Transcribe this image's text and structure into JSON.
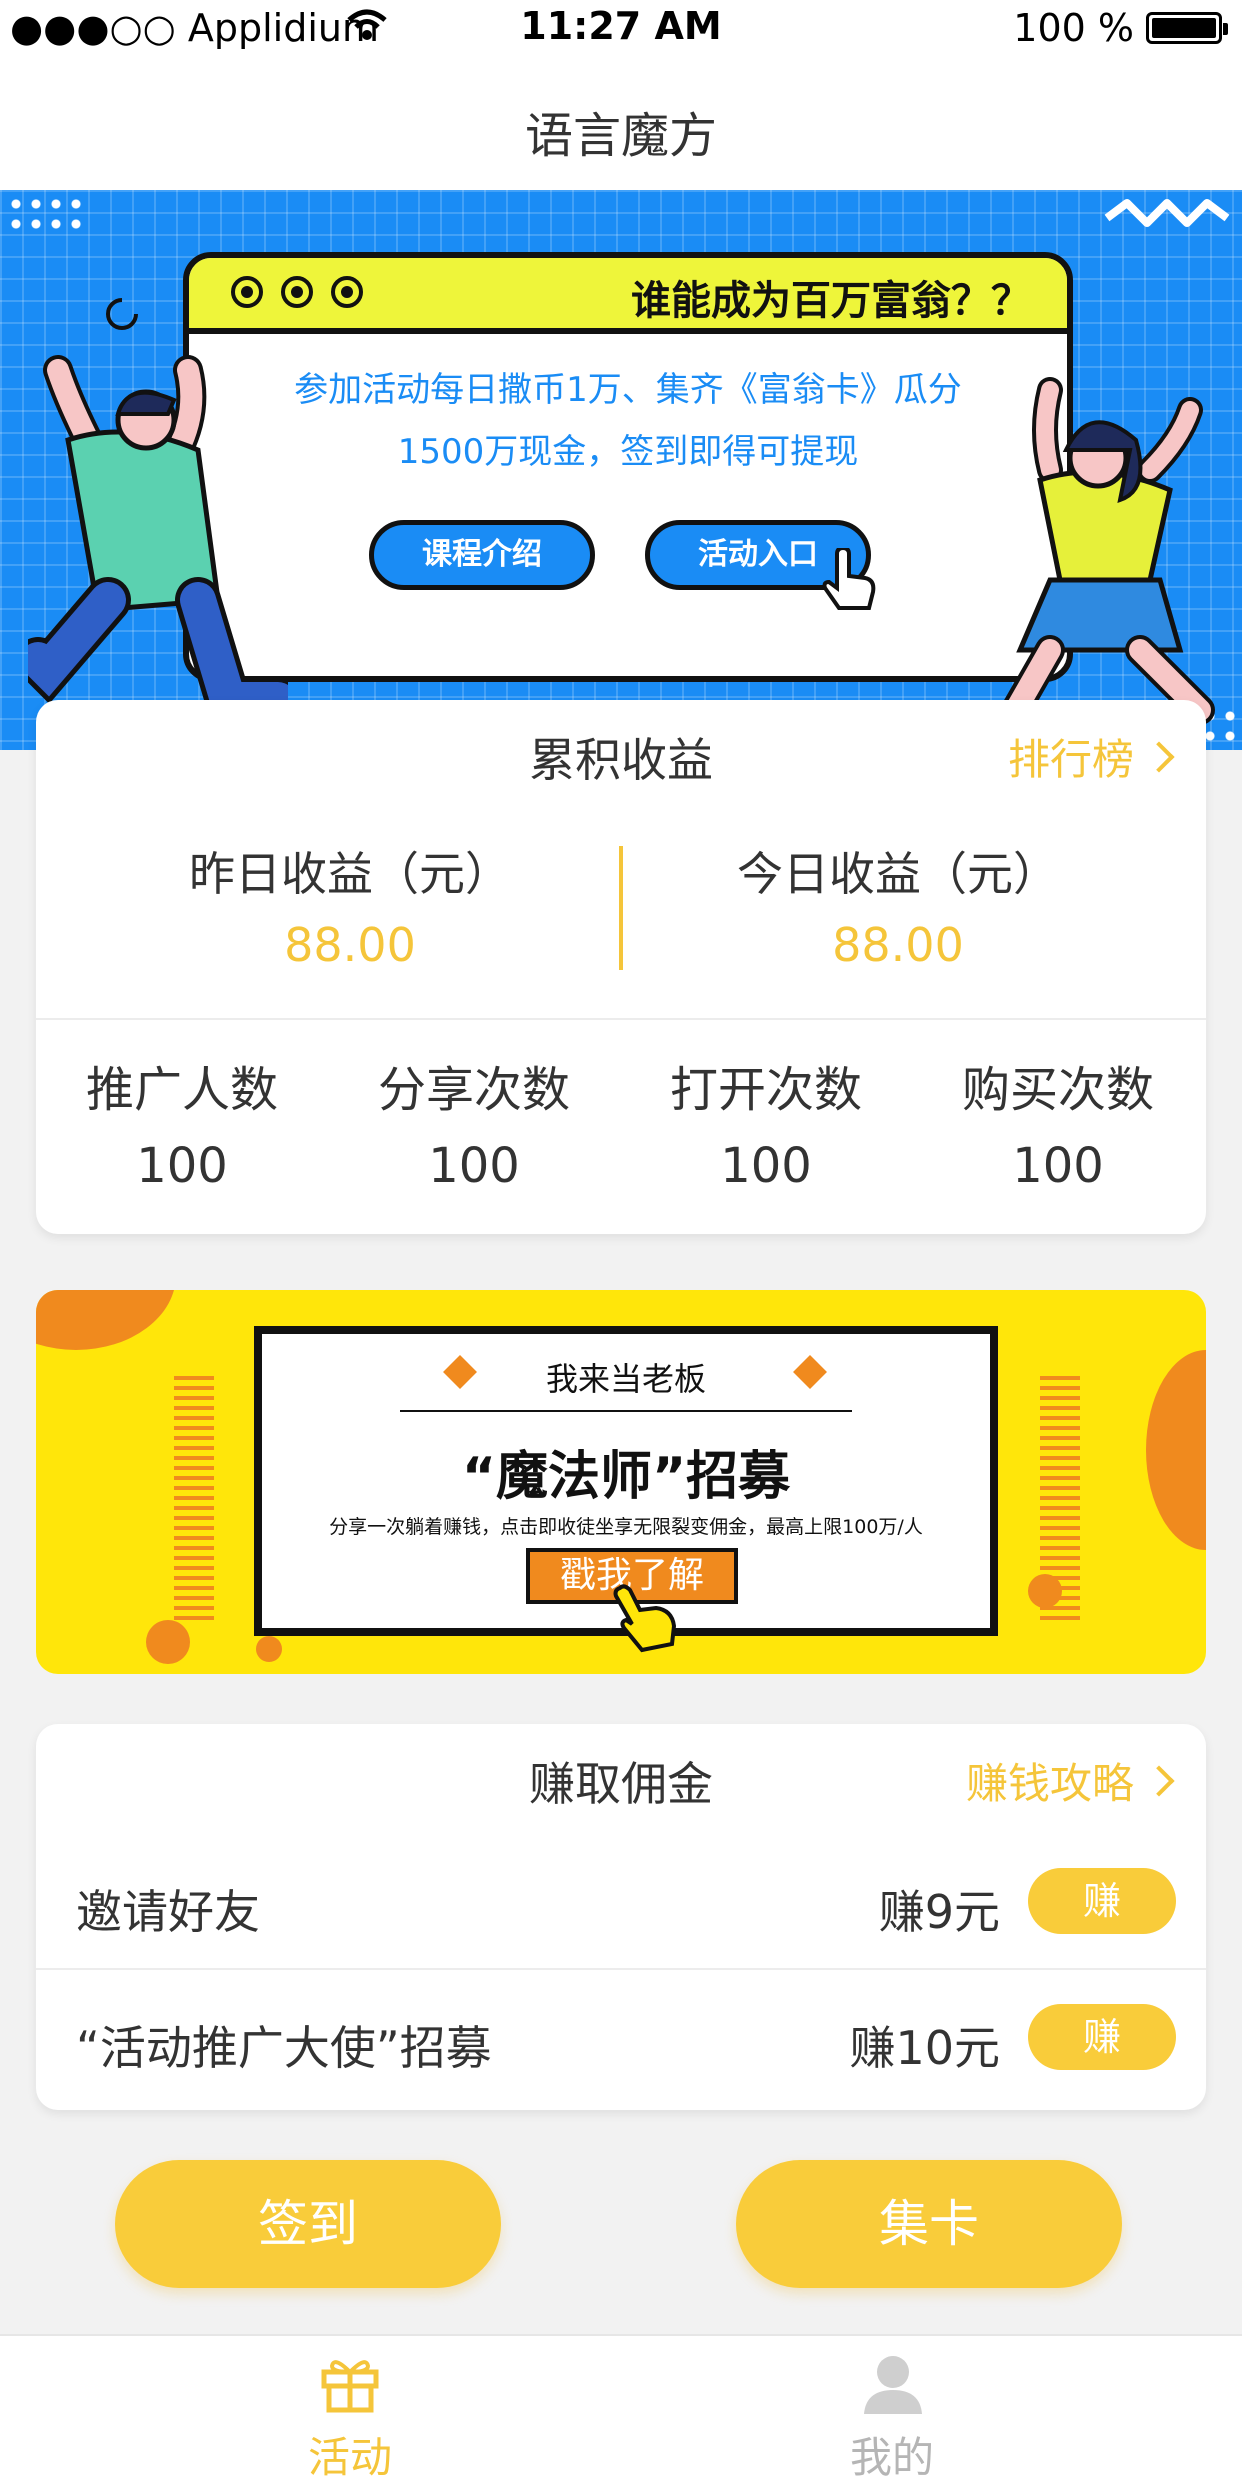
{
  "status_bar": {
    "carrier": "●●●○○ Applidium",
    "time": "11:27 AM",
    "battery": "100 %"
  },
  "app": {
    "title": "语言魔方"
  },
  "banner": {
    "headline": "谁能成为百万富翁？？",
    "line1": "参加活动每日撒币1万、集齐《富翁卡》瓜分",
    "line2": "1500万现金，签到即得可提现",
    "btn_course": "课程介绍",
    "btn_activity": "活动入口"
  },
  "earnings": {
    "title": "累积收益",
    "ranking_link": "排行榜",
    "yesterday_label": "昨日收益（元）",
    "yesterday_value": "88.00",
    "today_label": "今日收益（元）",
    "today_value": "88.00",
    "stats": [
      {
        "label": "推广人数",
        "value": "100"
      },
      {
        "label": "分享次数",
        "value": "100"
      },
      {
        "label": "打开次数",
        "value": "100"
      },
      {
        "label": "购买次数",
        "value": "100"
      }
    ]
  },
  "recruit": {
    "small_title": "我来当老板",
    "big_title": "“魔法师”招募",
    "desc": "分享一次躺着赚钱，点击即收徒坐享无限裂变佣金，最高上限100万/人",
    "button": "戳我了解"
  },
  "commission": {
    "title": "赚取佣金",
    "guide_link": "赚钱攻略",
    "tasks": [
      {
        "name": "邀请好友",
        "amount": "赚9元",
        "button": "赚"
      },
      {
        "name": "“活动推广大使”招募",
        "amount": "赚10元",
        "button": "赚"
      }
    ]
  },
  "actions": {
    "sign_in": "签到",
    "collect_cards": "集卡"
  },
  "tabbar": {
    "tabs": [
      {
        "label": "活动",
        "icon": "gift-icon",
        "active": true
      },
      {
        "label": "我的",
        "icon": "user-icon",
        "active": false
      }
    ]
  },
  "colors": {
    "accent": "#f9cc3a",
    "banner_blue": "#1a8cf5",
    "yellow": "#ffe60a",
    "orange": "#f08a1e"
  }
}
